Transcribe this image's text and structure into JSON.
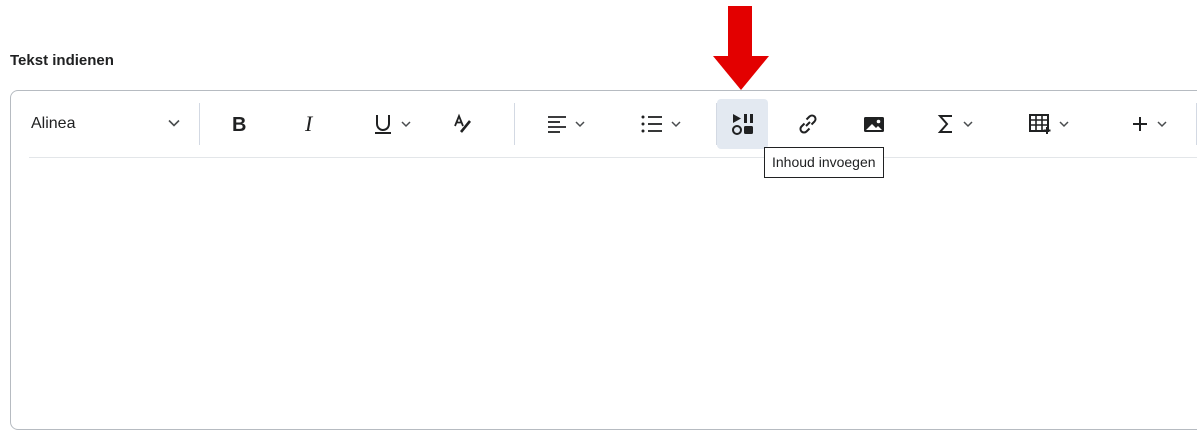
{
  "field": {
    "label": "Tekst indienen"
  },
  "toolbar": {
    "paragraph_select": "Alinea",
    "buttons": [
      {
        "name": "bold",
        "icon": "bold-icon"
      },
      {
        "name": "italic",
        "icon": "italic-icon"
      },
      {
        "name": "underline",
        "icon": "underline-icon",
        "dropdown": true
      },
      {
        "name": "text-format",
        "icon": "text-format-icon"
      },
      {
        "name": "align",
        "icon": "align-left-icon",
        "dropdown": true
      },
      {
        "name": "list",
        "icon": "list-icon",
        "dropdown": true
      },
      {
        "name": "insert-content",
        "icon": "insert-content-icon",
        "active": true
      },
      {
        "name": "link",
        "icon": "link-icon"
      },
      {
        "name": "image",
        "icon": "image-icon"
      },
      {
        "name": "equation",
        "icon": "sigma-icon",
        "dropdown": true
      },
      {
        "name": "table",
        "icon": "table-icon",
        "dropdown": true
      },
      {
        "name": "more",
        "icon": "plus-icon",
        "dropdown": true
      }
    ]
  },
  "tooltip": {
    "text": "Inhoud invoegen"
  },
  "annotation": {
    "arrow_color": "#e30000"
  },
  "colors": {
    "active_bg": "#e3e9f1",
    "border": "#b6bbc1",
    "text": "#202122"
  }
}
